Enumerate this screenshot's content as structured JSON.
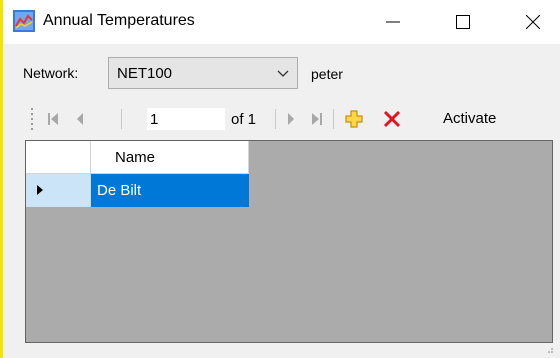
{
  "window": {
    "title": "Annual Temperatures",
    "controls": {
      "minimize": "minimize",
      "maximize": "maximize",
      "close": "close"
    }
  },
  "filter": {
    "network_label": "Network:",
    "network_value": "NET100",
    "user": "peter"
  },
  "navigator": {
    "position": "1",
    "of_label": "of 1",
    "activate_label": "Activate",
    "icons": [
      "move-first-icon",
      "move-previous-icon",
      "move-next-icon",
      "move-last-icon",
      "add-new-icon",
      "delete-icon"
    ]
  },
  "grid": {
    "columns": [
      "Name"
    ],
    "rows": [
      {
        "name": "De Bilt",
        "selected": true
      }
    ]
  },
  "colors": {
    "selection": "#0078d7",
    "row_header_selected": "#cce4f7",
    "grid_background": "#ababab",
    "delete_red": "#e81123",
    "add_yellow": "#f5b400",
    "window_accent": "#f2e600"
  }
}
